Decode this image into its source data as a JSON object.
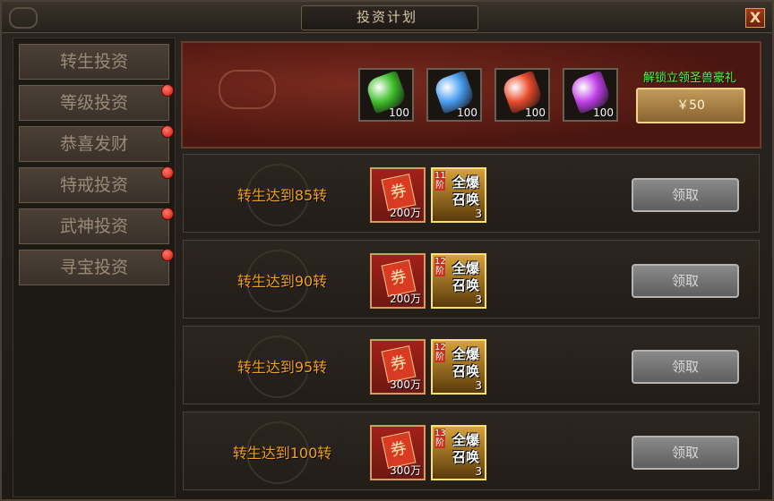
{
  "window": {
    "title": "投资计划",
    "close_label": "X"
  },
  "sidebar": {
    "items": [
      {
        "label": "转生投资",
        "active": true,
        "red_dot": false
      },
      {
        "label": "等级投资",
        "active": false,
        "red_dot": true
      },
      {
        "label": "恭喜发财",
        "active": false,
        "red_dot": true
      },
      {
        "label": "特戒投资",
        "active": false,
        "red_dot": true
      },
      {
        "label": "武神投资",
        "active": false,
        "red_dot": true
      },
      {
        "label": "寻宝投资",
        "active": false,
        "red_dot": true
      }
    ]
  },
  "banner": {
    "gems": [
      {
        "icon": "green-gem-icon",
        "color": "#3fbf2a",
        "count": "100"
      },
      {
        "icon": "blue-gem-icon",
        "color": "#4a9cf0",
        "count": "100"
      },
      {
        "icon": "red-gem-icon",
        "color": "#e84a2a",
        "count": "100"
      },
      {
        "icon": "purple-gem-icon",
        "color": "#c040e8",
        "count": "100"
      }
    ],
    "unlock_text": "解锁立领圣兽豪礼",
    "price_label": "￥50"
  },
  "rows": [
    {
      "label": "转生达到85转",
      "voucher_amount": "200万",
      "summon_stage": "11阶",
      "summon_text": "全爆召唤",
      "summon_qty": "3",
      "claim_label": "领取"
    },
    {
      "label": "转生达到90转",
      "voucher_amount": "200万",
      "summon_stage": "12阶",
      "summon_text": "全爆召唤",
      "summon_qty": "3",
      "claim_label": "领取"
    },
    {
      "label": "转生达到95转",
      "voucher_amount": "300万",
      "summon_stage": "12阶",
      "summon_text": "全爆召唤",
      "summon_qty": "3",
      "claim_label": "领取"
    },
    {
      "label": "转生达到100转",
      "voucher_amount": "300万",
      "summon_stage": "13阶",
      "summon_text": "全爆召唤",
      "summon_qty": "3",
      "claim_label": "领取"
    }
  ],
  "icons": {
    "voucher_glyph": "券"
  }
}
